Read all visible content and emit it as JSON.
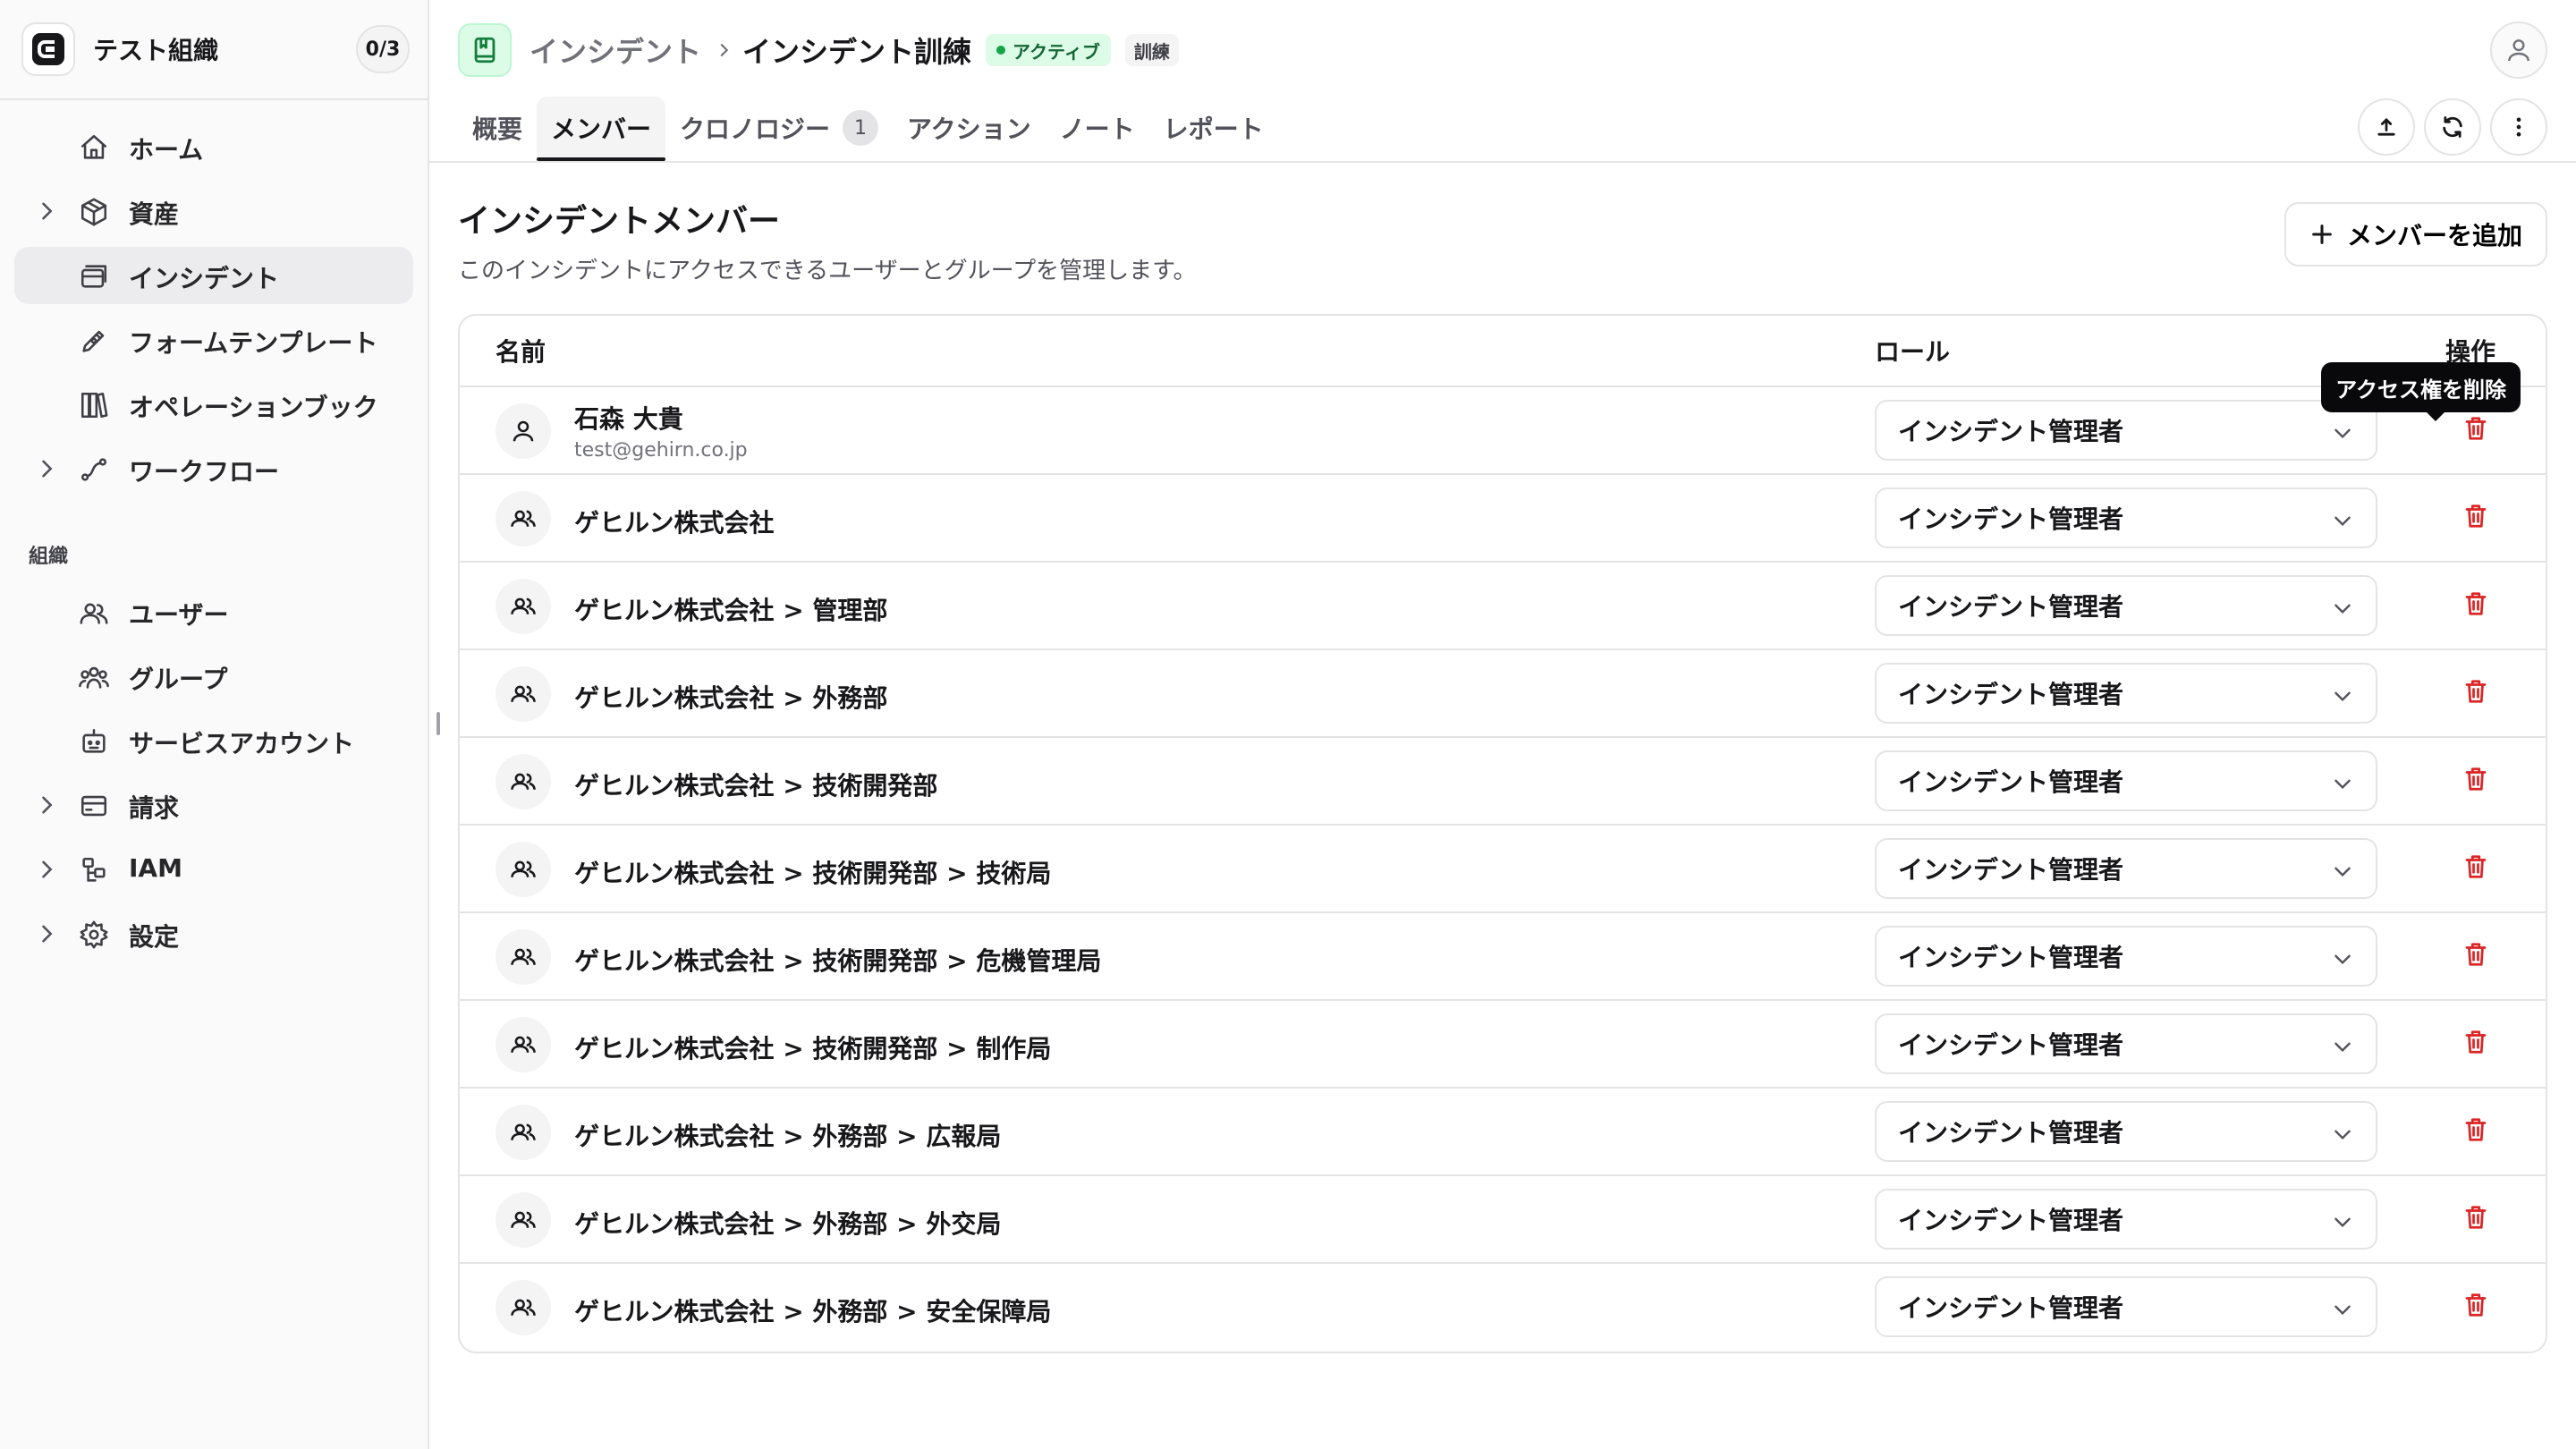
{
  "org": {
    "name": "テスト組織",
    "count": "0/3"
  },
  "sidebar": {
    "items": [
      {
        "label": "ホーム",
        "icon": "home-icon",
        "expandable": false,
        "active": false
      },
      {
        "label": "資産",
        "icon": "box-icon",
        "expandable": true,
        "active": false
      },
      {
        "label": "インシデント",
        "icon": "incident-icon",
        "expandable": false,
        "active": true
      },
      {
        "label": "フォームテンプレート",
        "icon": "form-template-icon",
        "expandable": false,
        "active": false
      },
      {
        "label": "オペレーションブック",
        "icon": "books-icon",
        "expandable": false,
        "active": false
      },
      {
        "label": "ワークフロー",
        "icon": "workflow-icon",
        "expandable": true,
        "active": false
      }
    ],
    "section_label": "組織",
    "org_items": [
      {
        "label": "ユーザー",
        "icon": "users-icon",
        "expandable": false
      },
      {
        "label": "グループ",
        "icon": "group-icon",
        "expandable": false
      },
      {
        "label": "サービスアカウント",
        "icon": "bot-icon",
        "expandable": false
      },
      {
        "label": "請求",
        "icon": "billing-icon",
        "expandable": true
      },
      {
        "label": "IAM",
        "icon": "iam-icon",
        "expandable": true
      },
      {
        "label": "設定",
        "icon": "gear-icon",
        "expandable": true
      }
    ]
  },
  "header": {
    "breadcrumb_parent": "インシデント",
    "breadcrumb_current": "インシデント訓練",
    "status_badge": "アクティブ",
    "type_badge": "訓練"
  },
  "tabs": [
    {
      "label": "概要",
      "active": false,
      "count": null
    },
    {
      "label": "メンバー",
      "active": true,
      "count": null
    },
    {
      "label": "クロノロジー",
      "active": false,
      "count": "1"
    },
    {
      "label": "アクション",
      "active": false,
      "count": null
    },
    {
      "label": "ノート",
      "active": false,
      "count": null
    },
    {
      "label": "レポート",
      "active": false,
      "count": null
    }
  ],
  "main": {
    "title": "インシデントメンバー",
    "description": "このインシデントにアクセスできるユーザーとグループを管理します。",
    "add_button": "メンバーを追加"
  },
  "table": {
    "columns": {
      "name": "名前",
      "role": "ロール",
      "action": "操作"
    },
    "tooltip": "アクセス権を削除",
    "rows": [
      {
        "type": "user",
        "name": "石森 大貴",
        "email": "test@gehirn.co.jp",
        "role": "インシデント管理者"
      },
      {
        "type": "group",
        "name": "ゲヒルン株式会社",
        "role": "インシデント管理者"
      },
      {
        "type": "group",
        "name": "ゲヒルン株式会社 > 管理部",
        "role": "インシデント管理者"
      },
      {
        "type": "group",
        "name": "ゲヒルン株式会社 > 外務部",
        "role": "インシデント管理者"
      },
      {
        "type": "group",
        "name": "ゲヒルン株式会社 > 技術開発部",
        "role": "インシデント管理者"
      },
      {
        "type": "group",
        "name": "ゲヒルン株式会社 > 技術開発部 > 技術局",
        "role": "インシデント管理者"
      },
      {
        "type": "group",
        "name": "ゲヒルン株式会社 > 技術開発部 > 危機管理局",
        "role": "インシデント管理者"
      },
      {
        "type": "group",
        "name": "ゲヒルン株式会社 > 技術開発部 > 制作局",
        "role": "インシデント管理者"
      },
      {
        "type": "group",
        "name": "ゲヒルン株式会社 > 外務部 > 広報局",
        "role": "インシデント管理者"
      },
      {
        "type": "group",
        "name": "ゲヒルン株式会社 > 外務部 > 外交局",
        "role": "インシデント管理者"
      },
      {
        "type": "group",
        "name": "ゲヒルン株式会社 > 外務部 > 安全保障局",
        "role": "インシデント管理者"
      }
    ]
  },
  "colors": {
    "accent": "#18181b",
    "danger": "#dc2626",
    "active_badge": "#dcfce7",
    "active_dot": "#16a34a"
  }
}
